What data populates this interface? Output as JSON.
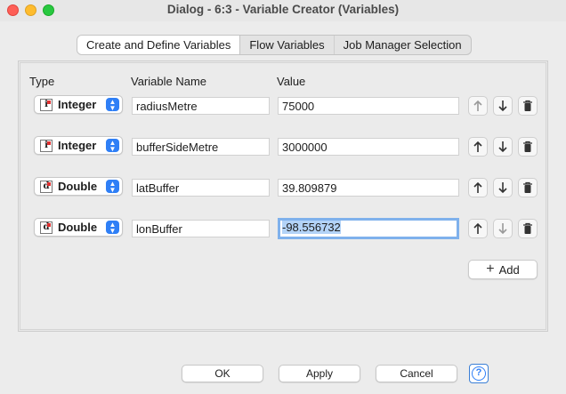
{
  "window": {
    "title": "Dialog - 6:3 - Variable Creator (Variables)"
  },
  "tabs": [
    {
      "label": "Create and Define Variables",
      "active": true
    },
    {
      "label": "Flow Variables",
      "active": false
    },
    {
      "label": "Job Manager Selection",
      "active": false
    }
  ],
  "columns": {
    "type": "Type",
    "name": "Variable Name",
    "value": "Value"
  },
  "rows": [
    {
      "type_icon": "i",
      "type": "Integer",
      "name": "radiusMetre",
      "value": "75000"
    },
    {
      "type_icon": "i",
      "type": "Integer",
      "name": "bufferSideMetre",
      "value": "3000000"
    },
    {
      "type_icon": "d",
      "type": "Double",
      "name": "latBuffer",
      "value": "39.809879"
    },
    {
      "type_icon": "d",
      "type": "Double",
      "name": "lonBuffer",
      "value": "-98.556732",
      "focused": true
    }
  ],
  "add_label": "Add",
  "buttons": {
    "ok": "OK",
    "apply": "Apply",
    "cancel": "Cancel",
    "help": "?"
  },
  "colors": {
    "accent": "#2f7ff6",
    "selection": "#b3d3f7"
  }
}
